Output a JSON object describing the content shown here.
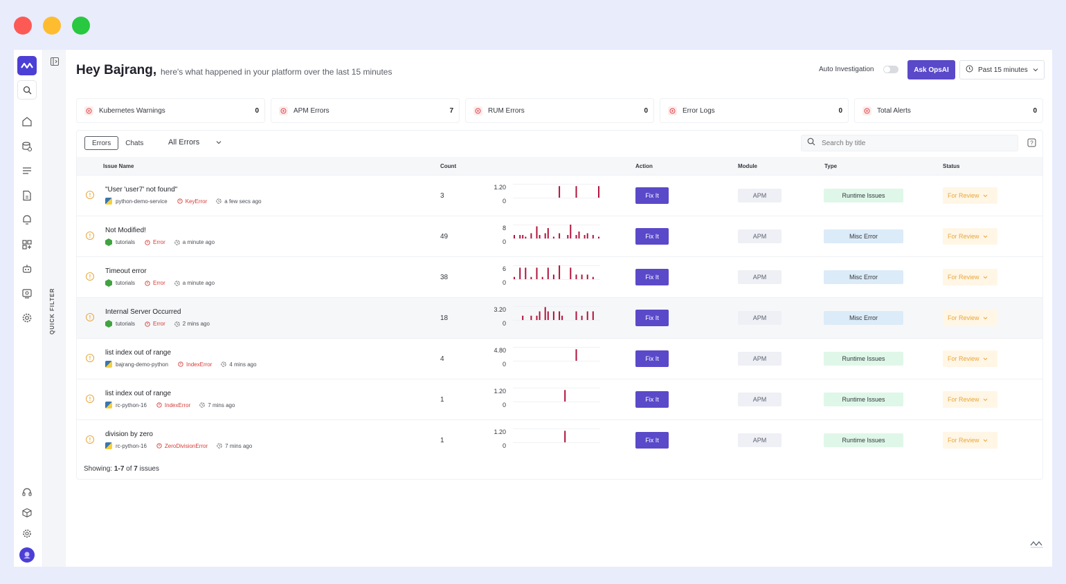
{
  "greeting": {
    "name": "Hey Bajrang,",
    "subtitle": "here's what happened in your platform over the last 15 minutes"
  },
  "header": {
    "auto_investigation_label": "Auto Investigation",
    "ask_button": "Ask OpsAI",
    "time_range": "Past 15 minutes"
  },
  "sidebar": {
    "quick_filter_label": "QUICK FILTER",
    "icons": [
      "logo-icon",
      "search-icon",
      "home-icon",
      "database-icon",
      "list-icon",
      "document-icon",
      "alert-icon",
      "dashboard-icon",
      "bot-icon",
      "monitor-icon",
      "settings-gear-icon",
      "headset-icon",
      "cube-icon",
      "gear-icon",
      "user-avatar"
    ]
  },
  "stats": [
    {
      "label": "Kubernetes Warnings",
      "value": "0"
    },
    {
      "label": "APM Errors",
      "value": "7"
    },
    {
      "label": "RUM Errors",
      "value": "0"
    },
    {
      "label": "Error Logs",
      "value": "0"
    },
    {
      "label": "Total Alerts",
      "value": "0"
    }
  ],
  "toolbar": {
    "tabs": [
      "Errors",
      "Chats"
    ],
    "active_tab": "Errors",
    "filter_value": "All Errors",
    "search_placeholder": "Search by title"
  },
  "table": {
    "columns": {
      "issue": "Issue Name",
      "count": "Count",
      "action": "Action",
      "module": "Module",
      "type": "Type",
      "status": "Status"
    },
    "rows": [
      {
        "title": "\"User 'user7' not found\"",
        "service": "python-demo-service",
        "service_icon": "python",
        "error": "KeyError",
        "time": "a few secs ago",
        "count": "3",
        "ymax": "1.20",
        "ymin": "0",
        "spark": [
          0,
          0,
          0,
          0,
          0,
          0,
          0,
          0,
          0,
          0,
          0,
          0,
          0,
          0,
          0,
          0,
          1,
          0,
          0,
          0,
          0,
          0,
          1,
          0,
          0,
          0,
          0,
          0,
          0,
          0,
          1
        ],
        "action": "Fix It",
        "module": "APM",
        "type": "Runtime Issues",
        "type_kind": "runtime",
        "status": "For Review"
      },
      {
        "title": "Not Modified!",
        "service": "tutorials",
        "service_icon": "node",
        "error": "Error",
        "time": "a minute ago",
        "count": "49",
        "ymax": "8",
        "ymin": "0",
        "spark": [
          2,
          0,
          2,
          2,
          1,
          0,
          3,
          0,
          7,
          2,
          0,
          3,
          6,
          0,
          1,
          0,
          3,
          0,
          0,
          2,
          8,
          0,
          2,
          4,
          0,
          2,
          3,
          0,
          2,
          0,
          1
        ],
        "action": "Fix It",
        "module": "APM",
        "type": "Misc Error",
        "type_kind": "misc",
        "status": "For Review"
      },
      {
        "title": "Timeout error",
        "service": "tutorials",
        "service_icon": "node",
        "error": "Error",
        "time": "a minute ago",
        "count": "38",
        "ymax": "6",
        "ymin": "0",
        "spark": [
          1,
          0,
          5,
          0,
          5,
          0,
          1,
          0,
          5,
          0,
          1,
          0,
          5,
          0,
          2,
          0,
          6,
          0,
          0,
          0,
          5,
          0,
          2,
          0,
          2,
          0,
          2,
          0,
          1,
          0,
          0
        ],
        "action": "Fix It",
        "module": "APM",
        "type": "Misc Error",
        "type_kind": "misc",
        "status": "For Review"
      },
      {
        "title": "Internal Server Occurred",
        "service": "tutorials",
        "service_icon": "node",
        "error": "Error",
        "time": "2 mins ago",
        "count": "18",
        "ymax": "3.20",
        "ymin": "0",
        "spark": [
          0,
          0,
          0,
          1,
          0,
          0,
          1,
          0,
          1,
          2,
          0,
          3,
          2,
          0,
          2,
          0,
          2,
          1,
          0,
          0,
          0,
          0,
          2,
          0,
          1,
          0,
          2,
          0,
          2,
          0,
          0
        ],
        "action": "Fix It",
        "module": "APM",
        "type": "Misc Error",
        "type_kind": "misc",
        "status": "For Review"
      },
      {
        "title": "list index out of range",
        "service": "bajrang-demo-python",
        "service_icon": "python",
        "error": "IndexError",
        "time": "4 mins ago",
        "count": "4",
        "ymax": "4.80",
        "ymin": "0",
        "spark": [
          0,
          0,
          0,
          0,
          0,
          0,
          0,
          0,
          0,
          0,
          0,
          0,
          0,
          0,
          0,
          0,
          0,
          0,
          0,
          0,
          0,
          0,
          4,
          0,
          0,
          0,
          0,
          0,
          0,
          0,
          0
        ],
        "action": "Fix It",
        "module": "APM",
        "type": "Runtime Issues",
        "type_kind": "runtime",
        "status": "For Review"
      },
      {
        "title": "list index out of range",
        "service": "rc-python-16",
        "service_icon": "python",
        "error": "IndexError",
        "time": "7 mins ago",
        "count": "1",
        "ymax": "1.20",
        "ymin": "0",
        "spark": [
          0,
          0,
          0,
          0,
          0,
          0,
          0,
          0,
          0,
          0,
          0,
          0,
          0,
          0,
          0,
          0,
          0,
          0,
          1,
          0,
          0,
          0,
          0,
          0,
          0,
          0,
          0,
          0,
          0,
          0,
          0
        ],
        "action": "Fix It",
        "module": "APM",
        "type": "Runtime Issues",
        "type_kind": "runtime",
        "status": "For Review"
      },
      {
        "title": "division by zero",
        "service": "rc-python-16",
        "service_icon": "python",
        "error": "ZeroDivisionError",
        "time": "7 mins ago",
        "count": "1",
        "ymax": "1.20",
        "ymin": "0",
        "spark": [
          0,
          0,
          0,
          0,
          0,
          0,
          0,
          0,
          0,
          0,
          0,
          0,
          0,
          0,
          0,
          0,
          0,
          0,
          1,
          0,
          0,
          0,
          0,
          0,
          0,
          0,
          0,
          0,
          0,
          0,
          0
        ],
        "action": "Fix It",
        "module": "APM",
        "type": "Runtime Issues",
        "type_kind": "runtime",
        "status": "For Review"
      }
    ]
  },
  "footer": {
    "showing_prefix": "Showing:",
    "showing_range": "1-7",
    "showing_of": "of",
    "showing_total": "7",
    "showing_suffix": "issues"
  },
  "colors": {
    "accent": "#5a49c9",
    "spark": "#b0123a",
    "error_text": "#d53a35",
    "review": "#e8a63a"
  }
}
